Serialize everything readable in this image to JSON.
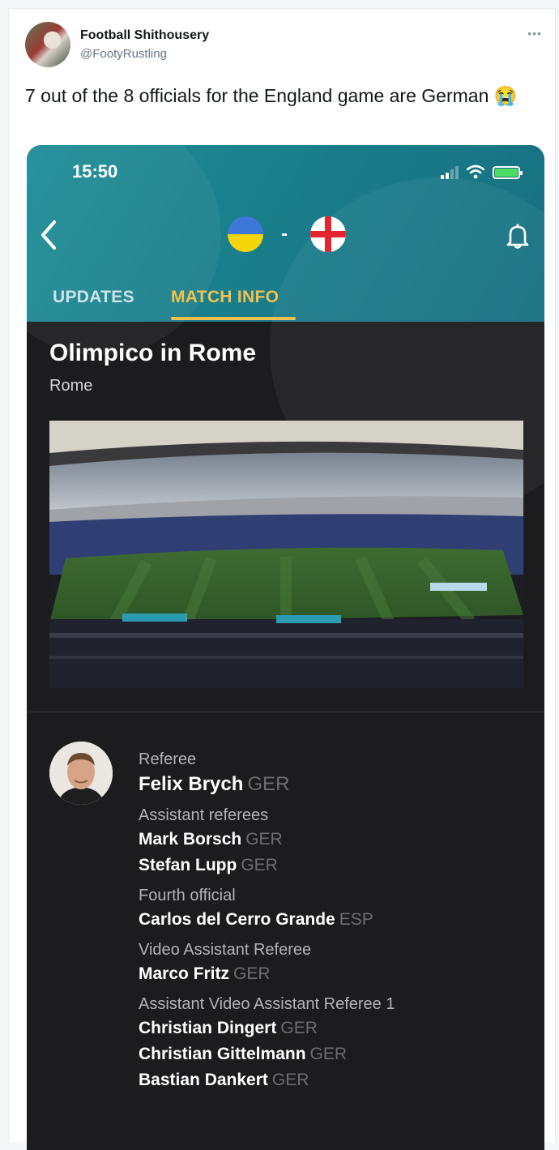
{
  "tweet": {
    "display_name": "Football Shithousery",
    "handle": "@FootyRustling",
    "more_icon": "more-horizontal-icon",
    "text": "7 out of the 8 officials for the England game are German 😭"
  },
  "app": {
    "status_time": "15:50",
    "match_separator": "-",
    "tabs": [
      {
        "label": "UPDATES",
        "active": false
      },
      {
        "label": "MATCH INFO",
        "active": true
      }
    ],
    "venue": {
      "name": "Olimpico in Rome",
      "city": "Rome"
    },
    "colors": {
      "header": "#1b7f8c",
      "active_tab": "#f2c14b",
      "background": "#1c1c1e"
    },
    "officials": [
      {
        "role": "Referee",
        "people": [
          {
            "name": "Felix Brych",
            "nat": "GER"
          }
        ]
      },
      {
        "role": "Assistant referees",
        "people": [
          {
            "name": "Mark Borsch",
            "nat": "GER"
          },
          {
            "name": "Stefan Lupp",
            "nat": "GER"
          }
        ]
      },
      {
        "role": "Fourth official",
        "people": [
          {
            "name": "Carlos del Cerro Grande",
            "nat": "ESP"
          }
        ]
      },
      {
        "role": "Video Assistant Referee",
        "people": [
          {
            "name": "Marco Fritz",
            "nat": "GER"
          }
        ]
      },
      {
        "role": "Assistant Video Assistant Referee 1",
        "people": [
          {
            "name": "Christian Dingert",
            "nat": "GER"
          },
          {
            "name": "Christian Gittelmann",
            "nat": "GER"
          },
          {
            "name": "Bastian Dankert",
            "nat": "GER"
          }
        ]
      }
    ]
  }
}
